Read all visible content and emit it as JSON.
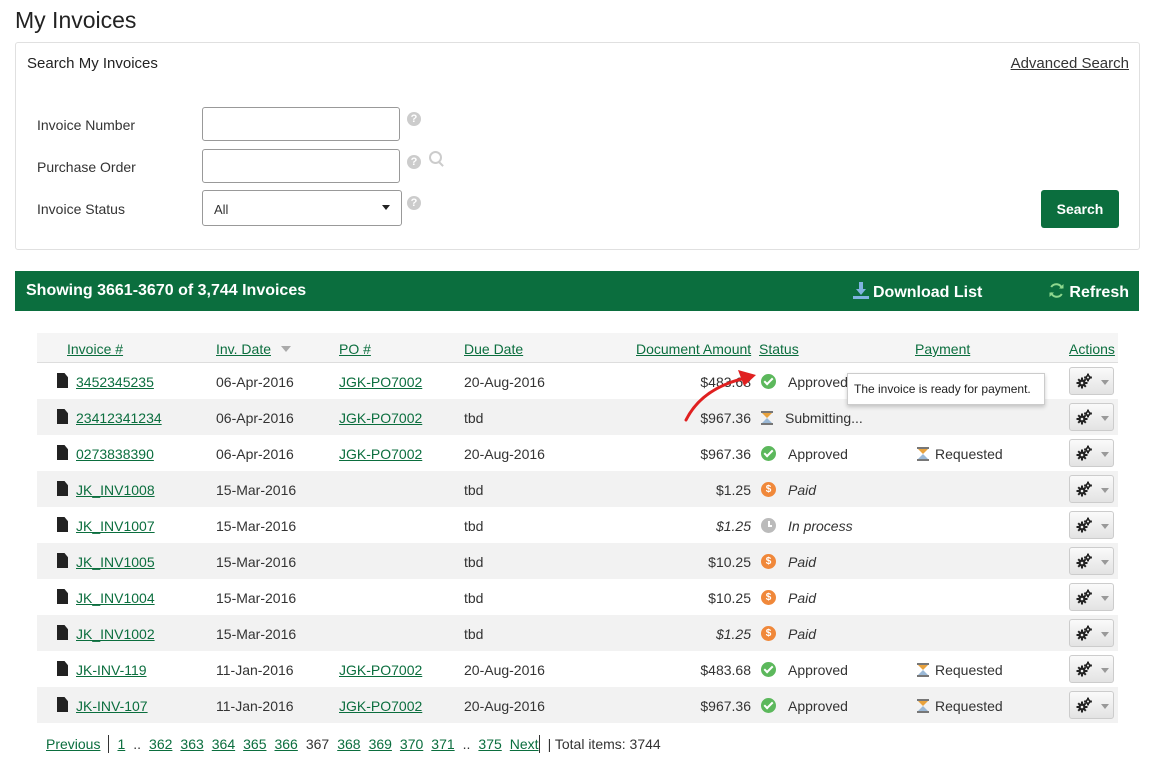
{
  "page_title": "My Invoices",
  "search_panel": {
    "title": "Search My Invoices",
    "advanced_search": "Advanced Search",
    "invoice_number_label": "Invoice Number",
    "invoice_number_value": "",
    "purchase_order_label": "Purchase Order",
    "purchase_order_value": "",
    "invoice_status_label": "Invoice Status",
    "invoice_status_value": "All",
    "help_glyph": "?",
    "search_button": "Search"
  },
  "results": {
    "count_text": "Showing 3661-3670 of 3,744 Invoices",
    "download_list": "Download List",
    "refresh": "Refresh"
  },
  "columns": {
    "invoice": "Invoice #",
    "inv_date": "Inv. Date",
    "po": "PO #",
    "due_date": "Due Date",
    "amount": "Document Amount",
    "status": "Status",
    "payment": "Payment",
    "actions": "Actions"
  },
  "rows": [
    {
      "invoice": "3452345235",
      "date": "06-Apr-2016",
      "po": "JGK-PO7002",
      "due": "20-Aug-2016",
      "amount": "$483.68",
      "amount_italic": false,
      "status": "Approved",
      "status_icon": "check-icon",
      "status_italic": false,
      "payment": "",
      "payment_icon": ""
    },
    {
      "invoice": "23412341234",
      "date": "06-Apr-2016",
      "po": "JGK-PO7002",
      "due": "tbd",
      "amount": "$967.36",
      "amount_italic": false,
      "status": "Submitting...",
      "status_icon": "hourglass-icon",
      "status_italic": false,
      "payment": "",
      "payment_icon": ""
    },
    {
      "invoice": "0273838390",
      "date": "06-Apr-2016",
      "po": "JGK-PO7002",
      "due": "20-Aug-2016",
      "amount": "$967.36",
      "amount_italic": false,
      "status": "Approved",
      "status_icon": "check-icon",
      "status_italic": false,
      "payment": "Requested",
      "payment_icon": "hourglass-icon"
    },
    {
      "invoice": "JK_INV1008",
      "date": "15-Mar-2016",
      "po": "",
      "due": "tbd",
      "amount": "$1.25",
      "amount_italic": false,
      "status": "Paid",
      "status_icon": "paid-icon",
      "status_italic": true,
      "payment": "",
      "payment_icon": ""
    },
    {
      "invoice": "JK_INV1007",
      "date": "15-Mar-2016",
      "po": "",
      "due": "tbd",
      "amount": "$1.25",
      "amount_italic": true,
      "status": "In process",
      "status_icon": "clock-icon",
      "status_italic": true,
      "payment": "",
      "payment_icon": ""
    },
    {
      "invoice": "JK_INV1005",
      "date": "15-Mar-2016",
      "po": "",
      "due": "tbd",
      "amount": "$10.25",
      "amount_italic": false,
      "status": "Paid",
      "status_icon": "paid-icon",
      "status_italic": true,
      "payment": "",
      "payment_icon": ""
    },
    {
      "invoice": "JK_INV1004",
      "date": "15-Mar-2016",
      "po": "",
      "due": "tbd",
      "amount": "$10.25",
      "amount_italic": false,
      "status": "Paid",
      "status_icon": "paid-icon",
      "status_italic": true,
      "payment": "",
      "payment_icon": ""
    },
    {
      "invoice": "JK_INV1002",
      "date": "15-Mar-2016",
      "po": "",
      "due": "tbd",
      "amount": "$1.25",
      "amount_italic": true,
      "status": "Paid",
      "status_icon": "paid-icon",
      "status_italic": true,
      "payment": "",
      "payment_icon": ""
    },
    {
      "invoice": "JK-INV-119",
      "date": "11-Jan-2016",
      "po": "JGK-PO7002",
      "due": "20-Aug-2016",
      "amount": "$483.68",
      "amount_italic": false,
      "status": "Approved",
      "status_icon": "check-icon",
      "status_italic": false,
      "payment": "Requested",
      "payment_icon": "hourglass-icon"
    },
    {
      "invoice": "JK-INV-107",
      "date": "11-Jan-2016",
      "po": "JGK-PO7002",
      "due": "20-Aug-2016",
      "amount": "$967.36",
      "amount_italic": false,
      "status": "Approved",
      "status_icon": "check-icon",
      "status_italic": false,
      "payment": "Requested",
      "payment_icon": "hourglass-icon"
    }
  ],
  "tooltip": "The invoice is ready for payment.",
  "pagination": {
    "previous": "Previous",
    "pages": [
      "1",
      "..",
      "362",
      "363",
      "364",
      "365",
      "366",
      "367",
      "368",
      "369",
      "370",
      "371",
      "..",
      "375"
    ],
    "current": "367",
    "next": "Next",
    "total": "| Total items: 3744"
  },
  "colors": {
    "brand": "#0b6e3e",
    "approved": "#5cb85c",
    "paid": "#f0883a",
    "in_process": "#bbbbbb",
    "annotation_arrow": "#e02020"
  }
}
